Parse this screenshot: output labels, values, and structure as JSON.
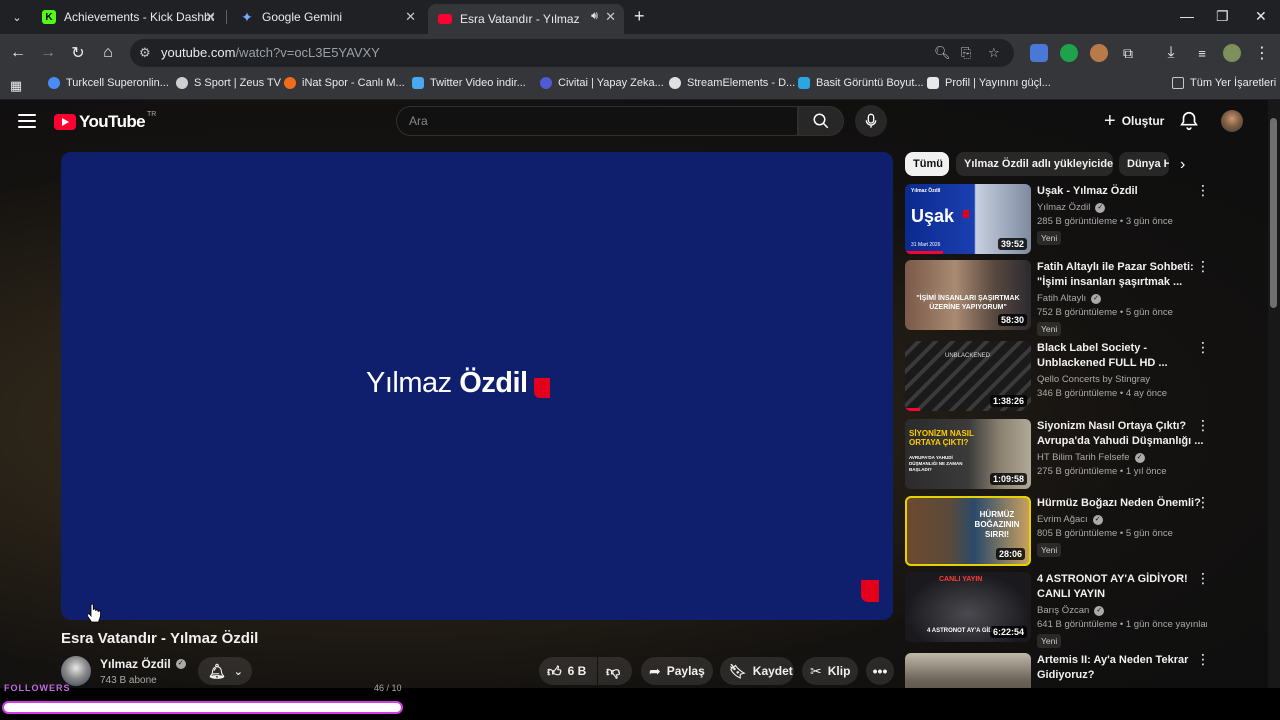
{
  "browser": {
    "tabs": [
      {
        "title": "Achievements - Kick Dashboard",
        "icon": "kick-icon"
      },
      {
        "title": "Google Gemini",
        "icon": "gemini-icon"
      },
      {
        "title": "Esra Vatandır - Yılmaz Özdil",
        "icon": "youtube-icon",
        "active": true
      }
    ],
    "new_tab": "+",
    "url_main": "youtube.com",
    "url_path": "/watch?v=ocL3E5YAVXY",
    "bookmarks": [
      {
        "label": "Turkcell Superonlin...",
        "color": "#4b8bf5"
      },
      {
        "label": "S Sport | Zeus TV",
        "color": "#cfcfcf"
      },
      {
        "label": "iNat Spor - Canlı M...",
        "color": "#f26b1d"
      },
      {
        "label": "Twitter Video indir...",
        "color": "#49a9f0"
      },
      {
        "label": "Civitai | Yapay Zeka...",
        "color": "#4f5bd5"
      },
      {
        "label": "StreamElements - D...",
        "color": "#e0e0e0"
      },
      {
        "label": "Basit Görüntü Boyut...",
        "color": "#2aa7e0"
      },
      {
        "label": "Profil | Yayınını güçl...",
        "color": "#e8e8e8"
      }
    ],
    "all_bookmarks": "Tüm Yer İşaretleri"
  },
  "youtube": {
    "logo_text": "YouTube",
    "country_code": "TR",
    "search_placeholder": "Ara",
    "create_label": "Oluştur",
    "video": {
      "brand_light": "Yılmaz ",
      "brand_bold": "Özdil",
      "title": "Esra Vatandır - Yılmaz Özdil",
      "channel": "Yılmaz Özdil",
      "subscribers": "743 B abone",
      "likes": "6 B",
      "share_label": "Paylaş",
      "save_label": "Kaydet",
      "clip_label": "Klip"
    },
    "chips": [
      "Tümü",
      "Yılmaz Özdil adlı yükleyiciden",
      "Dünya H"
    ],
    "recommendations": [
      {
        "title": "Uşak - Yılmaz Özdil",
        "channel": "Yılmaz Özdil",
        "verified": true,
        "meta": "285 B görüntüleme • 3 gün önce",
        "badge": "Yeni",
        "duration": "39:52",
        "thumb_text": "Uşak",
        "thumb_sub": "31 Mart 2026",
        "thumb_corner": "Yılmaz Özdil",
        "progress": 0.3
      },
      {
        "title": "Fatih Altaylı ile Pazar Sohbeti: \"İşimi insanları şaşırtmak ...",
        "channel": "Fatih Altaylı",
        "verified": true,
        "meta": "752 B görüntüleme • 5 gün önce",
        "badge": "Yeni",
        "duration": "58:30",
        "thumb_text": "\"İŞİMİ İNSANLARI ŞAŞIRTMAK ÜZERİNE YAPIYORUM\""
      },
      {
        "title": "Black Label Society - Unblackened FULL HD ...",
        "channel": "Qello Concerts by Stingray",
        "verified": false,
        "meta": "346 B görüntüleme • 4 ay önce",
        "badge": "",
        "duration": "1:38:26",
        "thumb_text": "UNBLACKENED",
        "progress": 0.12
      },
      {
        "title": "Siyonizm Nasıl Ortaya Çıktı? Avrupa'da Yahudi Düşmanlığı ...",
        "channel": "HT Bilim Tarih Felsefe",
        "verified": true,
        "meta": "275 B görüntüleme • 1 yıl önce",
        "badge": "",
        "duration": "1:09:58",
        "thumb_text": "SİYONİZM NASIL ORTAYA ÇIKTI?",
        "thumb_sub": "AVRUPA'DA YAHUDİ DÜŞMANLIĞI NE ZAMAN BAŞLADI?"
      },
      {
        "title": "Hürmüz Boğazı Neden Önemli?",
        "channel": "Evrim Ağacı",
        "verified": true,
        "meta": "805 B görüntüleme • 5 gün önce",
        "badge": "Yeni",
        "duration": "28:06",
        "thumb_text": "HÜRMÜZ BOĞAZININ SIRRI!"
      },
      {
        "title": "4 ASTRONOT AY'A GİDİYOR! CANLI YAYIN",
        "channel": "Barış Özcan",
        "verified": true,
        "meta": "641 B görüntüleme • 1 gün önce yayınlan...",
        "badge": "Yeni",
        "duration": "6:22:54",
        "thumb_text": "CANLI YAYIN",
        "thumb_sub": "4 ASTRONOT AY'A GİD"
      },
      {
        "title": "Artemis II: Ay'a Neden Tekrar Gidiyoruz?",
        "channel": "",
        "verified": false,
        "meta": "",
        "badge": "",
        "duration": "",
        "thumb_text": ""
      }
    ]
  },
  "overlay": {
    "followers_label": "FOLLOWERS",
    "followers_count": "46 / 10"
  },
  "colors": {
    "player_bg": "#0f1f6e",
    "brand_red": "#e3001b",
    "yt_red": "#ff0033",
    "follow_bar": "#d43ce8"
  }
}
